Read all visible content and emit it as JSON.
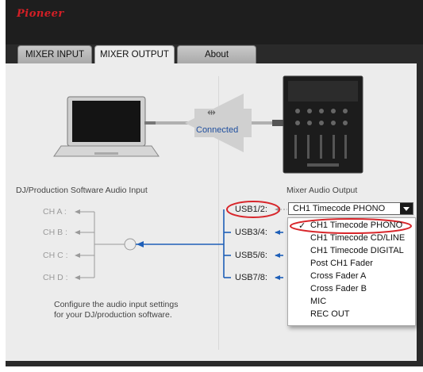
{
  "app": {
    "brand": "Pioneer",
    "brand_color": "#d41f26"
  },
  "tabs": [
    {
      "label": "MIXER INPUT",
      "active": false
    },
    {
      "label": "MIXER OUTPUT",
      "active": true
    },
    {
      "label": "About",
      "active": false
    }
  ],
  "connection": {
    "status": "Connected",
    "usb_icon": "usb-icon"
  },
  "left": {
    "title": "DJ/Production Software Audio Input",
    "channels": [
      "CH A :",
      "CH B :",
      "CH C :",
      "CH D :"
    ],
    "note_line1": "Configure the audio input settings",
    "note_line2": "for your DJ/production software."
  },
  "right": {
    "title": "Mixer Audio Output",
    "usb": [
      "USB1/2:",
      "USB3/4:",
      "USB5/6:",
      "USB7/8:"
    ],
    "selected_value": "CH1 Timecode PHONO",
    "options": [
      "CH1 Timecode PHONO",
      "CH1 Timecode CD/LINE",
      "CH1 Timecode DIGITAL",
      "Post CH1 Fader",
      "Cross Fader A",
      "Cross Fader B",
      "MIC",
      "REC OUT"
    ],
    "checked_option": "CH1 Timecode PHONO"
  },
  "colors": {
    "highlight": "#d8262b",
    "link_blue": "#1e5fb8"
  }
}
